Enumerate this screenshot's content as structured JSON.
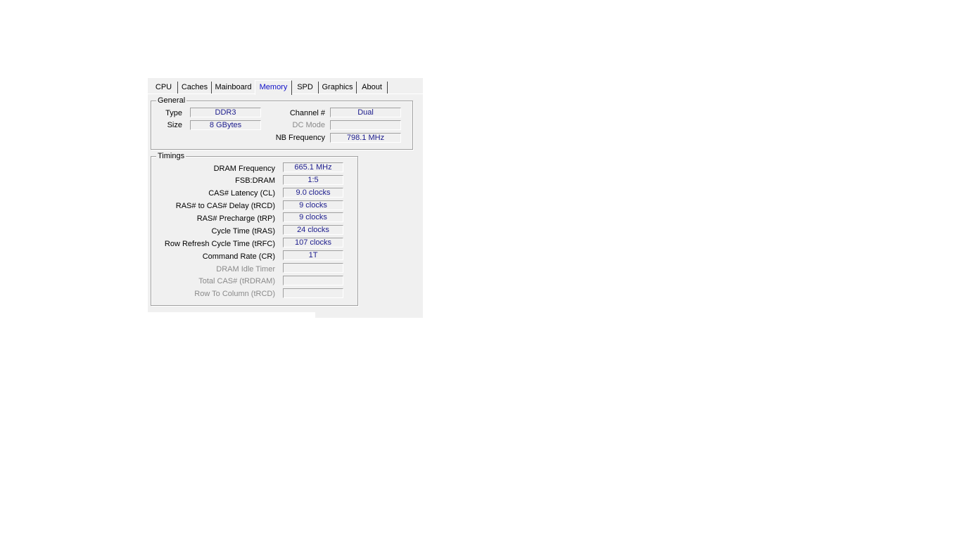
{
  "tabs": [
    {
      "label": "CPU"
    },
    {
      "label": "Caches"
    },
    {
      "label": "Mainboard"
    },
    {
      "label": "Memory"
    },
    {
      "label": "SPD"
    },
    {
      "label": "Graphics"
    },
    {
      "label": "About"
    }
  ],
  "active_tab": "Memory",
  "general": {
    "title": "General",
    "type_label": "Type",
    "type_value": "DDR3",
    "size_label": "Size",
    "size_value": "8 GBytes",
    "channel_label": "Channel #",
    "channel_value": "Dual",
    "dc_mode_label": "DC Mode",
    "dc_mode_value": "",
    "nb_freq_label": "NB Frequency",
    "nb_freq_value": "798.1 MHz"
  },
  "timings": {
    "title": "Timings",
    "rows": [
      {
        "label": "DRAM Frequency",
        "value": "665.1 MHz"
      },
      {
        "label": "FSB:DRAM",
        "value": "1:5"
      },
      {
        "label": "CAS# Latency (CL)",
        "value": "9.0 clocks"
      },
      {
        "label": "RAS# to CAS# Delay (tRCD)",
        "value": "9 clocks"
      },
      {
        "label": "RAS# Precharge (tRP)",
        "value": "9 clocks"
      },
      {
        "label": "Cycle Time (tRAS)",
        "value": "24 clocks"
      },
      {
        "label": "Row Refresh Cycle Time (tRFC)",
        "value": "107 clocks"
      },
      {
        "label": "Command Rate (CR)",
        "value": "1T"
      },
      {
        "label": "DRAM Idle Timer",
        "value": ""
      },
      {
        "label": "Total CAS# (tRDRAM)",
        "value": ""
      },
      {
        "label": "Row To Column (tRCD)",
        "value": ""
      }
    ]
  },
  "colors": {
    "value_text": "#1a1a8c",
    "active_tab_text": "#1010c8",
    "disabled_text": "#8a8a8a",
    "panel_bg": "#f0f0f0"
  }
}
